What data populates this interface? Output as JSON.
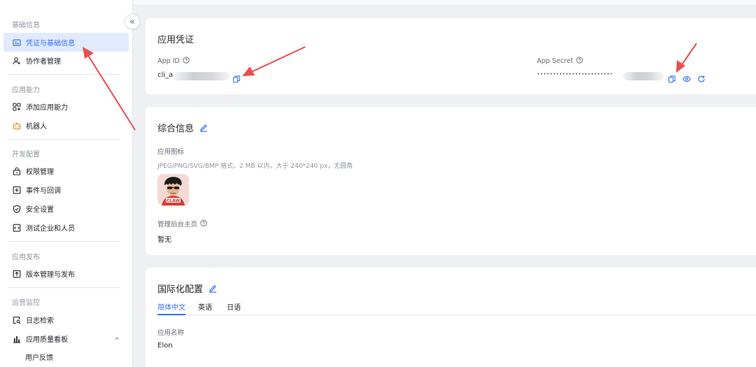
{
  "sidebar": {
    "collapse_icon": "«",
    "groups": [
      {
        "title": "基础信息",
        "items": [
          {
            "label": "凭证与基础信息",
            "icon": "credential-icon",
            "active": true
          },
          {
            "label": "协作者管理",
            "icon": "user-add-icon"
          }
        ]
      },
      {
        "title": "应用能力",
        "items": [
          {
            "label": "添加应用能力",
            "icon": "grid-add-icon"
          },
          {
            "label": "机器人",
            "icon": "robot-icon"
          }
        ]
      },
      {
        "title": "开发配置",
        "items": [
          {
            "label": "权限管理",
            "icon": "lock-icon"
          },
          {
            "label": "事件与回调",
            "icon": "event-icon"
          },
          {
            "label": "安全设置",
            "icon": "shield-icon"
          },
          {
            "label": "测试企业和人员",
            "icon": "code-box-icon"
          }
        ]
      },
      {
        "title": "应用发布",
        "items": [
          {
            "label": "版本管理与发布",
            "icon": "upload-box-icon"
          }
        ]
      },
      {
        "title": "运营监控",
        "items": [
          {
            "label": "日志检索",
            "icon": "log-search-icon"
          },
          {
            "label": "应用质量看板",
            "icon": "bar-chart-icon",
            "expandable": true
          },
          {
            "label": "用户反馈",
            "icon": null
          }
        ]
      }
    ]
  },
  "credentials": {
    "title": "应用凭证",
    "app_id_label": "App ID",
    "app_id_value": "cli_a",
    "app_secret_label": "App Secret",
    "app_secret_value": "••••••••••••••••••••••••"
  },
  "general": {
    "title": "综合信息",
    "icon_label": "应用图标",
    "icon_hint": "JPEG/PNG/SVG/BMP 格式，2 MB 以内，大于 240*240 px，无圆角",
    "app_icon_text": "CLAW",
    "home_label": "管理后台主页",
    "home_value": "暂无"
  },
  "i18n": {
    "title": "国际化配置",
    "tabs": [
      "简体中文",
      "英语",
      "日语"
    ],
    "active_tab": 0,
    "name_label": "应用名称",
    "name_value": "Elon"
  },
  "colors": {
    "accent": "#3370ff",
    "annotation_arrow": "#ec4d4d"
  }
}
